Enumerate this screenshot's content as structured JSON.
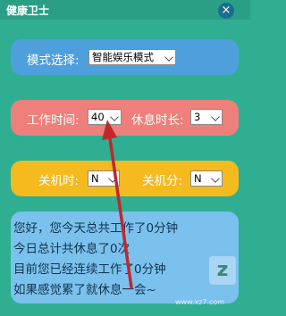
{
  "window": {
    "title": "健康卫士",
    "close_label": "×"
  },
  "mode": {
    "label": "模式选择:",
    "selected": "智能娱乐模式"
  },
  "work": {
    "work_label": "工作时间:",
    "work_value": "40",
    "rest_label": "休息时长:",
    "rest_value": "3"
  },
  "shutdown": {
    "hour_label": "关机时:",
    "hour_value": "N",
    "minute_label": "关机分:",
    "minute_value": "N"
  },
  "message": {
    "lines": [
      "您好，您今天总共工作了0分钟",
      "今日总计共休息了0次",
      "目前您已经连续工作了0分钟",
      "如果感觉累了就休息一会~"
    ]
  },
  "watermark": {
    "logo": "z",
    "text": "www.xz7.com"
  },
  "colors": {
    "background": "#2fae92",
    "mode_panel": "#4da0dc",
    "work_panel": "#ef7f7a",
    "shutdown_panel": "#f4ba1e",
    "message_panel": "#7bc1ee",
    "arrow": "#c0282c"
  }
}
